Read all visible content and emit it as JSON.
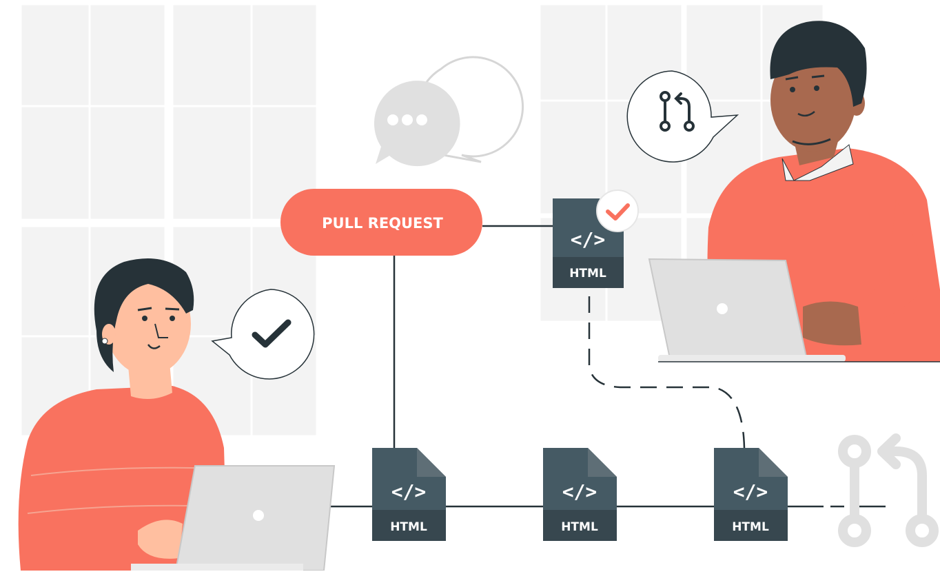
{
  "pill": {
    "label": "PULL REQUEST"
  },
  "files": {
    "review": {
      "code": "</>",
      "type": "HTML"
    },
    "main_1": {
      "code": "</>",
      "type": "HTML"
    },
    "main_2": {
      "code": "</>",
      "type": "HTML"
    },
    "main_3": {
      "code": "</>",
      "type": "HTML"
    }
  },
  "icons": {
    "chat": "chat-bubbles-icon",
    "pr_bubble": "git-pull-request-icon",
    "check_bubble": "checkmark-icon",
    "approved": "approved-check-badge-icon",
    "branch_end": "git-pull-request-icon"
  },
  "colors": {
    "accent": "#F9725F",
    "file_dark": "#455A64",
    "file_label_bg": "#37474F",
    "window_tile": "#F3F3F3",
    "laptop": "#E0E0E0",
    "line": "#263238",
    "skin_woman": "#FFBFA0",
    "skin_man": "#A8694F",
    "hair": "#263238"
  }
}
